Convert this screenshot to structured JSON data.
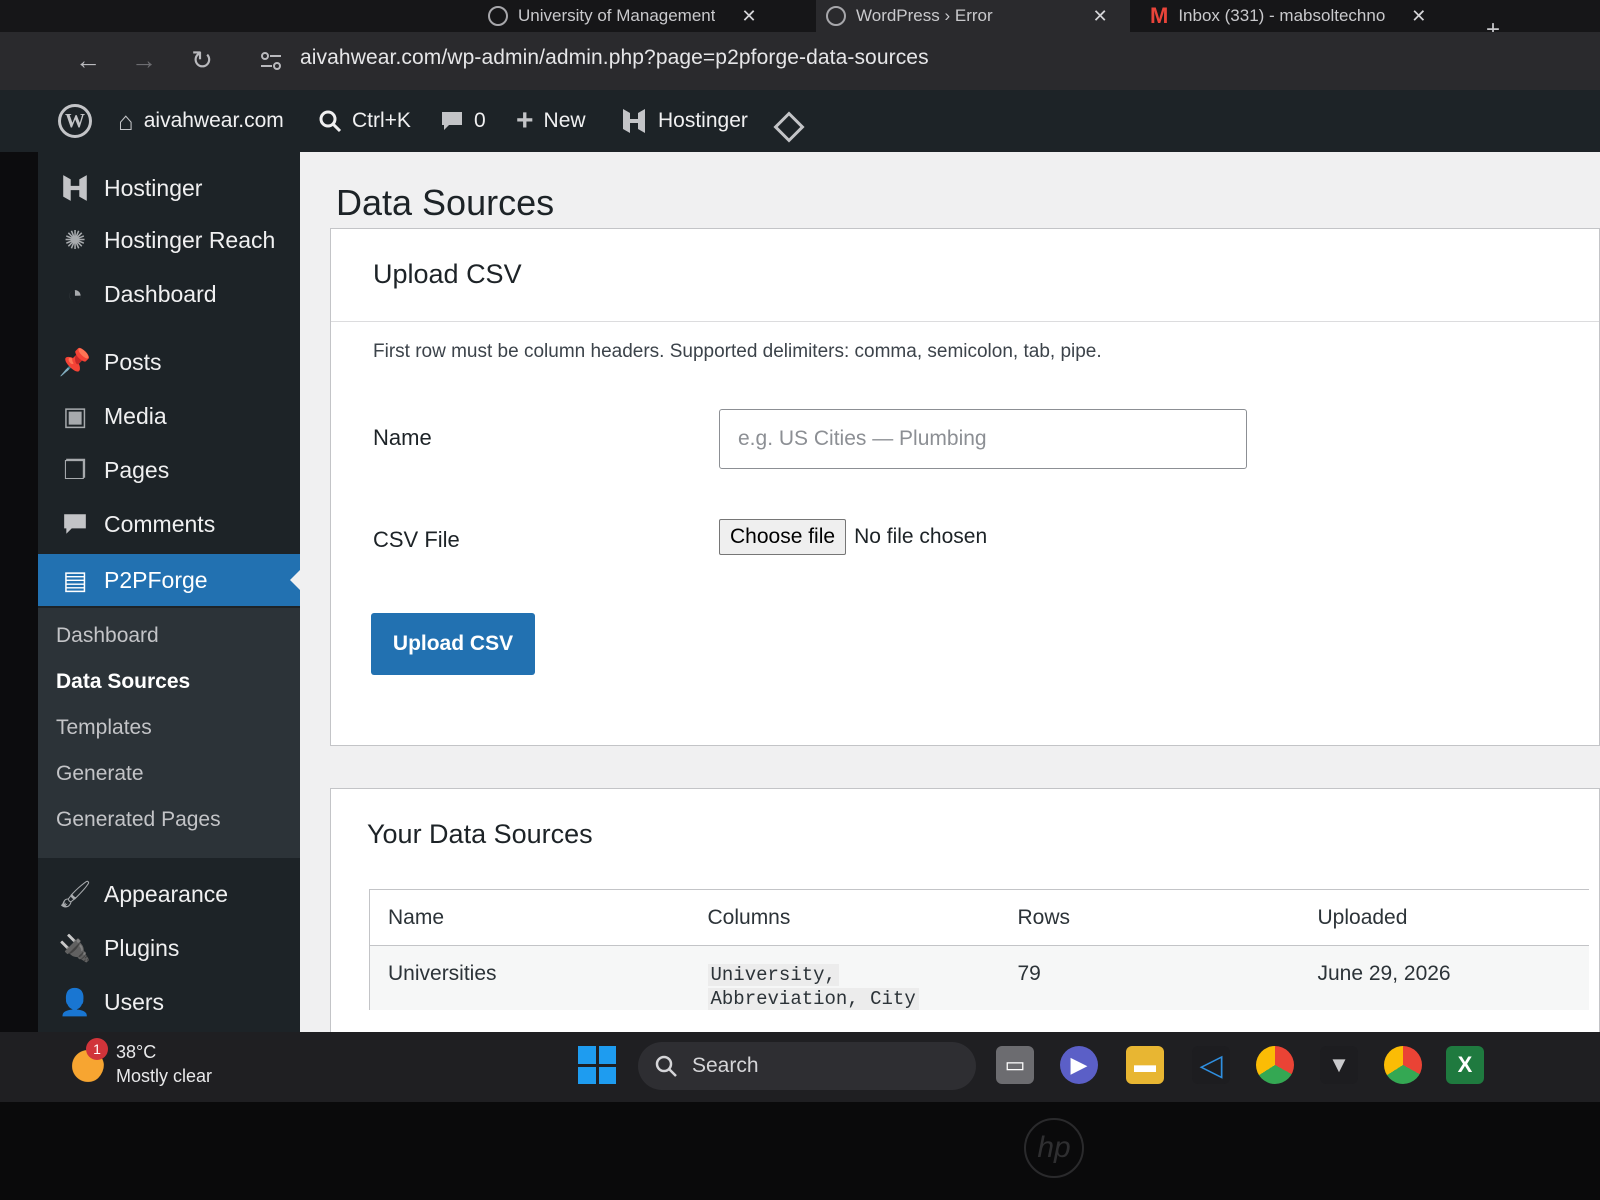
{
  "browser": {
    "tabs": [
      {
        "title": "University of Management",
        "close": "✕"
      },
      {
        "title": "WordPress › Error",
        "close": "✕"
      },
      {
        "title": "Inbox (331) - mabsoltechno",
        "close": "✕"
      }
    ],
    "new_tab": "+",
    "url": "aivahwear.com/wp-admin/admin.php?page=p2pforge-data-sources"
  },
  "adminbar": {
    "site_name": "aivahwear.com",
    "search_shortcut": "Ctrl+K",
    "comments_count": "0",
    "new_label": "New",
    "hostinger_label": "Hostinger",
    "right_text": "Ho"
  },
  "sidebar": {
    "items": [
      {
        "label": "Hostinger",
        "icon": "hostinger-icon"
      },
      {
        "label": "Hostinger Reach",
        "icon": "reach-icon"
      },
      {
        "label": "Dashboard",
        "icon": "dashboard-icon"
      },
      {
        "label": "Posts",
        "icon": "pin-icon"
      },
      {
        "label": "Media",
        "icon": "media-icon"
      },
      {
        "label": "Pages",
        "icon": "pages-icon"
      },
      {
        "label": "Comments",
        "icon": "comment-icon"
      },
      {
        "label": "P2PForge",
        "icon": "document-icon"
      },
      {
        "label": "Appearance",
        "icon": "brush-icon"
      },
      {
        "label": "Plugins",
        "icon": "plug-icon"
      },
      {
        "label": "Users",
        "icon": "user-icon"
      }
    ],
    "submenu": [
      "Dashboard",
      "Data Sources",
      "Templates",
      "Generate",
      "Generated Pages"
    ]
  },
  "main": {
    "page_title": "Data Sources",
    "upload": {
      "title": "Upload CSV",
      "description": "First row must be column headers. Supported delimiters: comma, semicolon, tab, pipe.",
      "name_label": "Name",
      "name_placeholder": "e.g. US Cities — Plumbing",
      "csv_label": "CSV File",
      "choose_file": "Choose file",
      "no_file": "No file chosen",
      "submit": "Upload CSV"
    },
    "sources": {
      "title": "Your Data Sources",
      "columns": [
        "Name",
        "Columns",
        "Rows",
        "Uploaded"
      ],
      "rows": [
        {
          "name": "Universities",
          "columns_line1": "University,",
          "columns_line2": "Abbreviation, City",
          "rows": "79",
          "uploaded": "June 29, 2026"
        }
      ]
    }
  },
  "taskbar": {
    "temperature": "38°C",
    "condition": "Mostly clear",
    "weather_badge": "1",
    "search_label": "Search"
  },
  "colors": {
    "wp_blue": "#2271b1",
    "admin_dark": "#1d2327"
  }
}
